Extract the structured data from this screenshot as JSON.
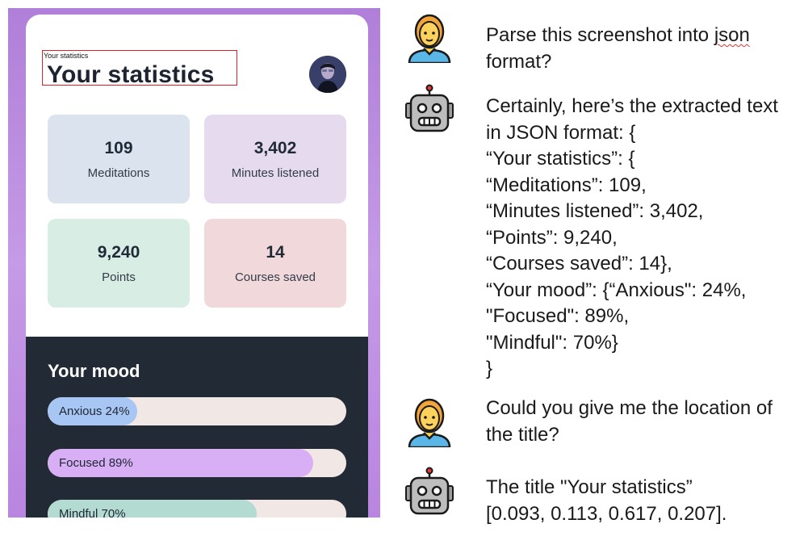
{
  "app": {
    "small_label": "Your statistics",
    "title": "Your statistics",
    "stats": [
      {
        "value": "109",
        "label": "Meditations",
        "bg": "#dbe3ee"
      },
      {
        "value": "3,402",
        "label": "Minutes listened",
        "bg": "#e6dbee"
      },
      {
        "value": "9,240",
        "label": "Points",
        "bg": "#d8ede4"
      },
      {
        "value": "14",
        "label": "Courses saved",
        "bg": "#f1d8da"
      }
    ],
    "mood": {
      "title": "Your mood",
      "bars": [
        {
          "label": "Anxious 24%",
          "value": 24,
          "color": "#a8c6f4"
        },
        {
          "label": "Focused 89%",
          "value": 89,
          "color": "#d8aef5"
        },
        {
          "label": "Mindful 70%",
          "value": 70,
          "color": "#b3dbd2"
        }
      ]
    }
  },
  "chat": {
    "user_q1": [
      "Parse this screenshot into json",
      "format?"
    ],
    "user_q1_underlined_word": "json",
    "bot_a1": [
      "Certainly, here’s the extracted text",
      "in JSON format: {",
      "“Your statistics”: {",
      "“Meditations”: 109,",
      "“Minutes listened”: 3,402,",
      "“Points”: 9,240,",
      "“Courses saved”: 14},",
      "“Your mood”: {“Anxious\": 24%,",
      "\"Focused\": 89%,",
      "\"Mindful\": 70%}",
      "}"
    ],
    "user_q2": [
      "Could you give me the location of",
      "the title?"
    ],
    "bot_a2": [
      "The title \"Your statistics”",
      "[0.093, 0.113, 0.617, 0.207]."
    ]
  },
  "icons": {
    "user": "person-emoji-icon",
    "bot": "robot-emoji-icon"
  }
}
